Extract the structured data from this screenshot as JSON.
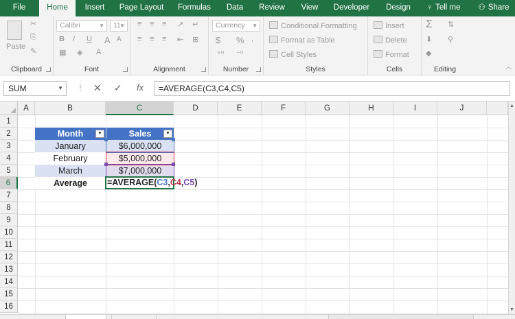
{
  "tabs": [
    {
      "label": "File",
      "active": false
    },
    {
      "label": "Home",
      "active": true
    },
    {
      "label": "Insert",
      "active": false
    },
    {
      "label": "Page Layout",
      "active": false
    },
    {
      "label": "Formulas",
      "active": false
    },
    {
      "label": "Data",
      "active": false
    },
    {
      "label": "Review",
      "active": false
    },
    {
      "label": "View",
      "active": false
    },
    {
      "label": "Developer",
      "active": false
    },
    {
      "label": "Design",
      "active": false
    }
  ],
  "tell_me": "Tell me",
  "share": "Share",
  "ribbon": {
    "clipboard": {
      "label": "Clipboard",
      "paste": "Paste"
    },
    "font": {
      "label": "Font",
      "name": "Calibri",
      "size": "11",
      "bold": "B",
      "italic": "I",
      "underline": "U",
      "grow": "A",
      "shrink": "A"
    },
    "alignment": {
      "label": "Alignment"
    },
    "number": {
      "label": "Number",
      "format": "Currency",
      "dollar": "$",
      "percent": "%"
    },
    "styles": {
      "label": "Styles",
      "conditional": "Conditional Formatting",
      "table": "Format as Table",
      "cell_styles": "Cell Styles"
    },
    "cells": {
      "label": "Cells",
      "insert": "Insert",
      "delete": "Delete",
      "format": "Format"
    },
    "editing": {
      "label": "Editing"
    }
  },
  "formula_bar": {
    "name_box": "SUM",
    "cancel": "✕",
    "enter": "✓",
    "fx": "fx",
    "formula": "=AVERAGE(C3,C4,C5)"
  },
  "columns": [
    "A",
    "B",
    "C",
    "D",
    "E",
    "F",
    "G",
    "H",
    "I",
    "J"
  ],
  "rows": [
    "1",
    "2",
    "3",
    "4",
    "5",
    "6",
    "7",
    "8",
    "9",
    "10",
    "11",
    "12",
    "13",
    "14",
    "15",
    "16"
  ],
  "table": {
    "headers": [
      "Month",
      "Sales"
    ],
    "filter_glyph": "▼",
    "rows": [
      {
        "month": "January",
        "sales": "$6,000,000"
      },
      {
        "month": "February",
        "sales": "$5,000,000"
      },
      {
        "month": "March",
        "sales": "$7,000,000"
      }
    ],
    "total_label": "Average"
  },
  "edit_cell": {
    "prefix": "=AVERAGE(",
    "ref1": "C3",
    "sep1": ",",
    "ref2": "C4",
    "sep2": ",",
    "ref3": "C5",
    "suffix": ")"
  },
  "colors": {
    "excel_green": "#217346",
    "table_header": "#4472c4",
    "table_band": "#d9e1f2",
    "ref_blue": "#4a78c2",
    "ref_red": "#c0304a",
    "ref_purple": "#7a4bb0"
  }
}
